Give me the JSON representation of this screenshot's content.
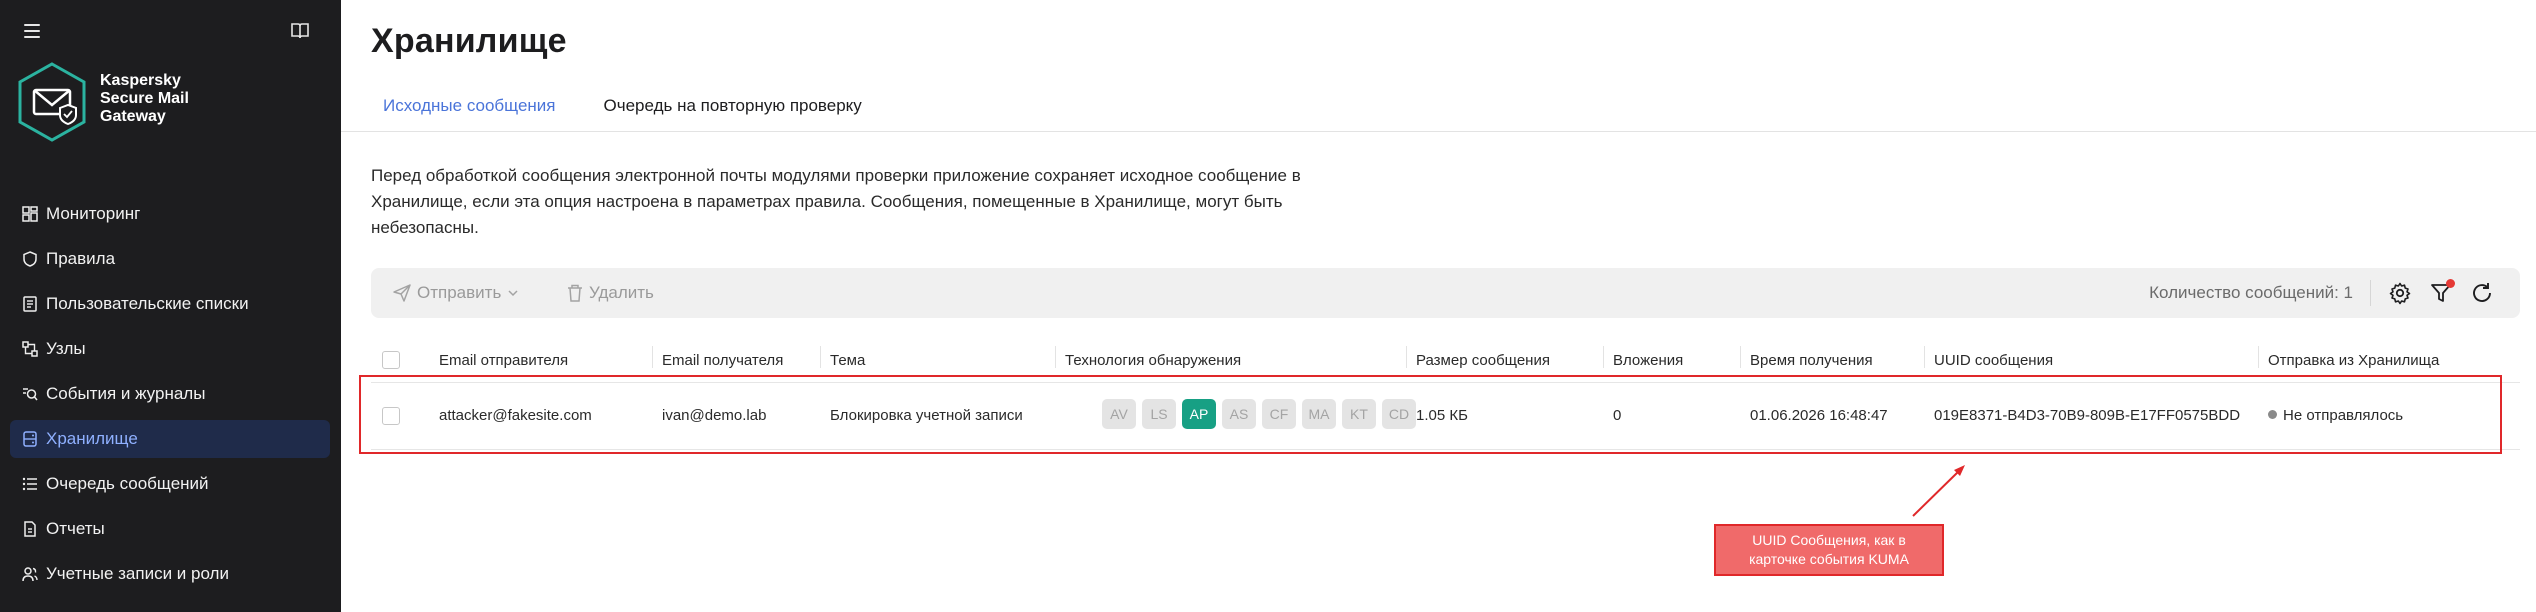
{
  "sidebar": {
    "brand": "Kaspersky\nSecure Mail\nGateway",
    "items": [
      {
        "label": "Мониторинг",
        "icon": "dashboard-icon"
      },
      {
        "label": "Правила",
        "icon": "shield-icon"
      },
      {
        "label": "Пользовательские списки",
        "icon": "list-doc-icon"
      },
      {
        "label": "Узлы",
        "icon": "nodes-icon"
      },
      {
        "label": "События и журналы",
        "icon": "events-search-icon"
      },
      {
        "label": "Хранилище",
        "icon": "storage-icon",
        "active": true
      },
      {
        "label": "Очередь сообщений",
        "icon": "queue-list-icon"
      },
      {
        "label": "Отчеты",
        "icon": "report-icon"
      },
      {
        "label": "Учетные записи и роли",
        "icon": "users-icon"
      }
    ]
  },
  "page": {
    "title": "Хранилище",
    "tabs": [
      {
        "label": "Исходные сообщения",
        "active": true
      },
      {
        "label": "Очередь на повторную проверку",
        "active": false
      }
    ],
    "description": "Перед обработкой сообщения электронной почты модулями проверки приложение сохраняет исходное сообщение в Хранилище, если эта опция настроена в параметрах правила. Сообщения, помещенные в Хранилище, могут быть небезопасны."
  },
  "toolbar": {
    "send_label": "Отправить",
    "delete_label": "Удалить",
    "count_label": "Количество сообщений: 1"
  },
  "table": {
    "columns": [
      "Email отправителя",
      "Email получателя",
      "Тема",
      "Технология обнаружения",
      "Размер сообщения",
      "Вложения",
      "Время получения",
      "UUID сообщения",
      "Отправка из Хранилища"
    ],
    "rows": [
      {
        "sender": "attacker@fakesite.com",
        "recipient": "ivan@demo.lab",
        "subject": "Блокировка учетной записи",
        "tech": [
          {
            "code": "AV",
            "active": false
          },
          {
            "code": "LS",
            "active": false
          },
          {
            "code": "AP",
            "active": true
          },
          {
            "code": "AS",
            "active": false
          },
          {
            "code": "CF",
            "active": false
          },
          {
            "code": "MA",
            "active": false
          },
          {
            "code": "KT",
            "active": false
          },
          {
            "code": "CD",
            "active": false
          }
        ],
        "size": "1.05 КБ",
        "attachments": "0",
        "received": "01.06.2026 16:48:47",
        "uuid": "019E8371-B4D3-70B9-809B-E17FF0575BDD",
        "send_status": "Не отправлялось"
      }
    ]
  },
  "annotation": {
    "text": "UUID Сообщения, как в\nкарточке события KUMA",
    "color": "#e0282a"
  },
  "colors": {
    "sidebar_bg": "#1d1d1f",
    "active_nav_bg": "#1f2b4a",
    "accent": "#4a74d9",
    "badge_active": "#17a084",
    "logo": "#2bb3a0"
  }
}
